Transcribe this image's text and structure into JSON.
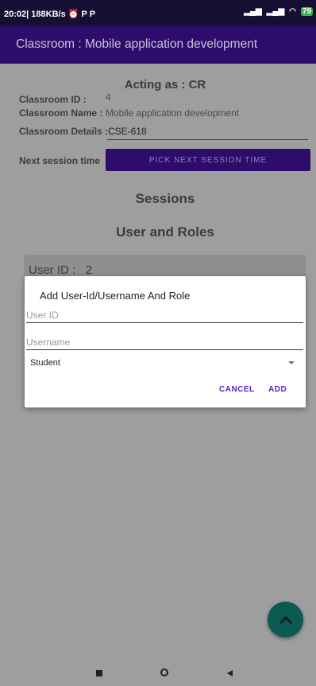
{
  "status": {
    "time": "20:02",
    "net": "| 188KB/s",
    "battery": "79"
  },
  "appbar": {
    "title": "Classroom : Mobile application development"
  },
  "classroom": {
    "acting_as": "Acting as : CR",
    "id_label": "Classroom ID :",
    "id_value": "4",
    "name_label": "Classroom Name :",
    "name_value": "Mobile application development",
    "details_label": "Classroom Details :",
    "details_value": "CSE-618",
    "next_session_label": "Next session time",
    "pick_button": "PICK NEXT SESSION TIME"
  },
  "sections": {
    "sessions": "Sessions",
    "user_roles": "User and Roles"
  },
  "user_card": {
    "label": "User ID :",
    "value": "2"
  },
  "dialog": {
    "title": "Add User-Id/Username And Role",
    "user_id_placeholder": "User ID",
    "username_placeholder": "Username",
    "role_selected": "Student",
    "cancel": "CANCEL",
    "add": "ADD"
  },
  "colors": {
    "accent": "#2e0c6b",
    "fab": "#0d5a52",
    "dialog_button": "#5b1fbf"
  }
}
